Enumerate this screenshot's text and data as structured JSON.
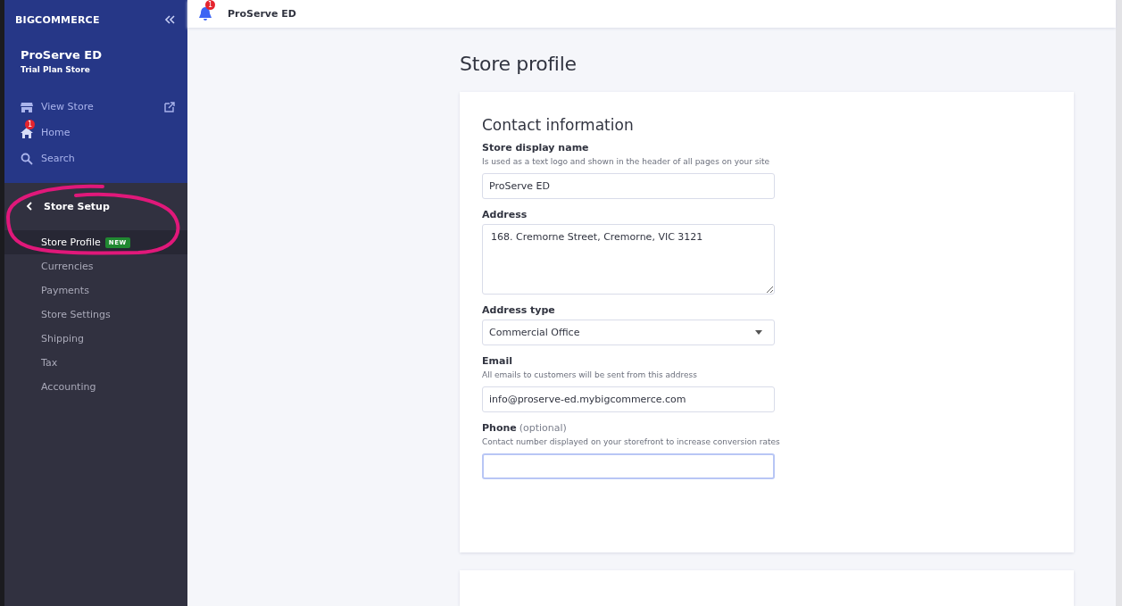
{
  "sidebar": {
    "logo": "BIGCOMMERCE",
    "store_name": "ProServe ED",
    "plan": "Trial Plan Store",
    "nav": [
      {
        "kind": "store",
        "label": "View Store"
      },
      {
        "kind": "home",
        "label": "Home",
        "badge": "1"
      },
      {
        "kind": "search",
        "label": "Search"
      }
    ],
    "section": {
      "title": "Store Setup",
      "items": [
        {
          "label": "Store Profile",
          "tag": "NEW",
          "selected": true
        },
        {
          "label": "Currencies",
          "selected": false
        },
        {
          "label": "Payments",
          "selected": false
        },
        {
          "label": "Store Settings",
          "selected": false
        },
        {
          "label": "Shipping",
          "selected": false
        },
        {
          "label": "Tax",
          "selected": false
        },
        {
          "label": "Accounting",
          "selected": false
        }
      ]
    }
  },
  "header": {
    "notification_count": "1",
    "store_name": "ProServe ED"
  },
  "page": {
    "title": "Store profile",
    "card": {
      "title": "Contact information",
      "fields": [
        {
          "kind": "text",
          "label": "Store display name",
          "hint": "Is used as a text logo and shown in the header of all pages on your site",
          "value": "ProServe ED",
          "focused": false
        },
        {
          "kind": "textarea",
          "label": "Address",
          "value": "168. Cremorne Street, Cremorne, VIC 3121",
          "focused": false
        },
        {
          "kind": "select",
          "label": "Address type",
          "value": "Commercial Office",
          "focused": false
        },
        {
          "kind": "text",
          "label": "Email",
          "hint": "All emails to customers will be sent from this address",
          "value": "info@proserve-ed.mybigcommerce.com",
          "focused": false
        },
        {
          "kind": "text",
          "label": "Phone",
          "note": "(optional)",
          "hint": "Contact number displayed on your storefront to increase conversion rates",
          "focused": true
        }
      ]
    }
  }
}
